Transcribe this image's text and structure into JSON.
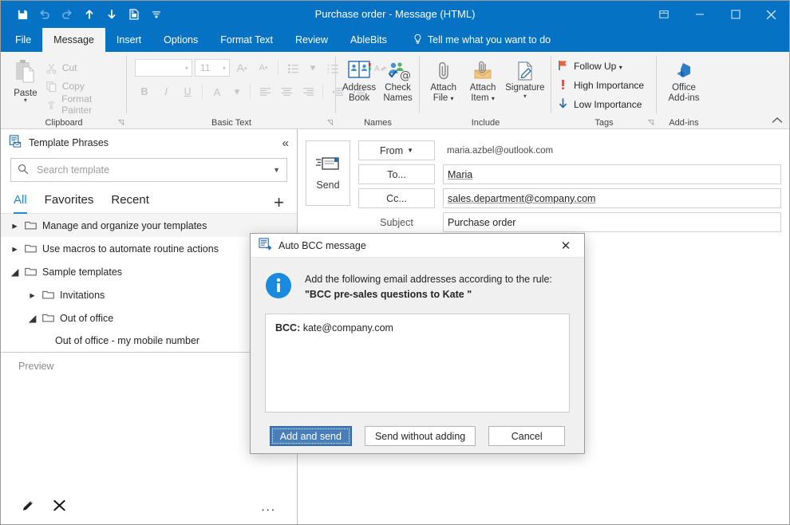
{
  "window": {
    "title": "Purchase order  -  Message (HTML)",
    "quick_access": [
      {
        "name": "save-icon",
        "label": "Save",
        "enabled": true
      },
      {
        "name": "undo-icon",
        "label": "Undo",
        "enabled": false
      },
      {
        "name": "redo-icon",
        "label": "Redo",
        "enabled": false
      },
      {
        "name": "previous-item-icon",
        "label": "Previous Item",
        "enabled": true
      },
      {
        "name": "next-item-icon",
        "label": "Next Item",
        "enabled": true
      },
      {
        "name": "print-preview-icon",
        "label": "Print Preview",
        "enabled": true
      },
      {
        "name": "customize-quick-access-toolbar-icon",
        "label": "Customize Quick Access Toolbar",
        "enabled": true
      }
    ],
    "controls": {
      "ribbon_display_options": "Ribbon Display Options",
      "minimize": "Minimize",
      "maximize": "Maximize",
      "close": "Close"
    },
    "accent_color": "#0572c4"
  },
  "ribbon": {
    "tabs": [
      {
        "label": "File",
        "active": false
      },
      {
        "label": "Message",
        "active": true
      },
      {
        "label": "Insert",
        "active": false
      },
      {
        "label": "Options",
        "active": false
      },
      {
        "label": "Format Text",
        "active": false
      },
      {
        "label": "Review",
        "active": false
      },
      {
        "label": "AbleBits",
        "active": false
      }
    ],
    "tell_me": "Tell me what you want to do",
    "collapse_ribbon": "Collapse the Ribbon",
    "groups": {
      "clipboard": {
        "label": "Clipboard",
        "paste": "Paste",
        "commands": [
          "Cut",
          "Copy",
          "Format Painter"
        ]
      },
      "basic_text": {
        "label": "Basic Text",
        "font_name": "",
        "font_size": "11",
        "buttons": [
          "Grow Font",
          "Shrink Font",
          "Bullets",
          "Numbering",
          "Clear All Formatting",
          "Bold",
          "Italic",
          "Underline",
          "Font Color",
          "Align Left",
          "Center",
          "Align Right",
          "Decrease Indent",
          "Increase Indent"
        ]
      },
      "names": {
        "label": "Names",
        "items": [
          {
            "line1": "Address",
            "line2": "Book",
            "caret": false
          },
          {
            "line1": "Check",
            "line2": "Names",
            "caret": false
          }
        ]
      },
      "include": {
        "label": "Include",
        "items": [
          {
            "line1": "Attach",
            "line2": "File",
            "caret": true
          },
          {
            "line1": "Attach",
            "line2": "Item",
            "caret": true
          },
          {
            "line1": "Signature",
            "line2": "",
            "caret": true
          }
        ]
      },
      "tags": {
        "label": "Tags",
        "items": [
          {
            "label": "Follow Up",
            "caret": true,
            "icon": "flag-icon"
          },
          {
            "label": "High Importance",
            "caret": false,
            "icon": "exclamation-icon"
          },
          {
            "label": "Low Importance",
            "caret": false,
            "icon": "arrow-down-icon"
          }
        ]
      },
      "addins": {
        "label": "Add-ins",
        "items": [
          {
            "line1": "Office",
            "line2": "Add-ins",
            "caret": false
          }
        ]
      }
    }
  },
  "sidebar": {
    "title": "Template Phrases",
    "collapse": "«",
    "search": {
      "value": "",
      "placeholder": "Search template"
    },
    "tabs": [
      {
        "label": "All",
        "active": true
      },
      {
        "label": "Favorites",
        "active": false
      },
      {
        "label": "Recent",
        "active": false
      }
    ],
    "add_label": "+",
    "tree": [
      {
        "label": "Manage and organize your templates",
        "level": 1,
        "expanded": false,
        "selected": true
      },
      {
        "label": "Use macros to automate routine actions",
        "level": 1,
        "expanded": false,
        "selected": false
      },
      {
        "label": "Sample templates",
        "level": 1,
        "expanded": true,
        "selected": false
      },
      {
        "label": "Invitations",
        "level": 2,
        "expanded": false,
        "selected": false
      },
      {
        "label": "Out of office",
        "level": 2,
        "expanded": true,
        "selected": false
      },
      {
        "label": "Out of office - my mobile number",
        "level": 3,
        "leaf": true,
        "selected": false
      }
    ],
    "preview_placeholder": "Preview",
    "footer": [
      {
        "name": "edit-icon",
        "label": "Edit"
      },
      {
        "name": "delete-icon",
        "label": "Delete"
      },
      {
        "name": "more-options-icon",
        "label": "..."
      }
    ]
  },
  "compose": {
    "send_label": "Send",
    "fields": [
      {
        "name": "from",
        "button": "From",
        "caret": true,
        "value": "maria.azbel@outlook.com",
        "boxed": false,
        "underline": false
      },
      {
        "name": "to",
        "button": "To...",
        "caret": false,
        "value": "Maria",
        "boxed": true,
        "underline": true
      },
      {
        "name": "cc",
        "button": "Cc...",
        "caret": false,
        "value": "sales.department@company.com",
        "boxed": true,
        "underline": true
      },
      {
        "name": "subject",
        "button": "Subject",
        "caret": false,
        "value": "Purchase order",
        "boxed": true,
        "underline": false
      }
    ],
    "body": ""
  },
  "dialog": {
    "title": "Auto BCC message",
    "close": "✕",
    "icon": "info-icon",
    "message_line1": "Add the following email addresses according to the rule:",
    "message_line2": "\"BCC pre-sales questions to Kate \"",
    "list": [
      {
        "prefix": "BCC:",
        "value": "kate@company.com"
      }
    ],
    "buttons": [
      {
        "label": "Add and send",
        "primary": true
      },
      {
        "label": "Send without adding",
        "primary": false
      },
      {
        "label": "Cancel",
        "primary": false
      }
    ]
  }
}
